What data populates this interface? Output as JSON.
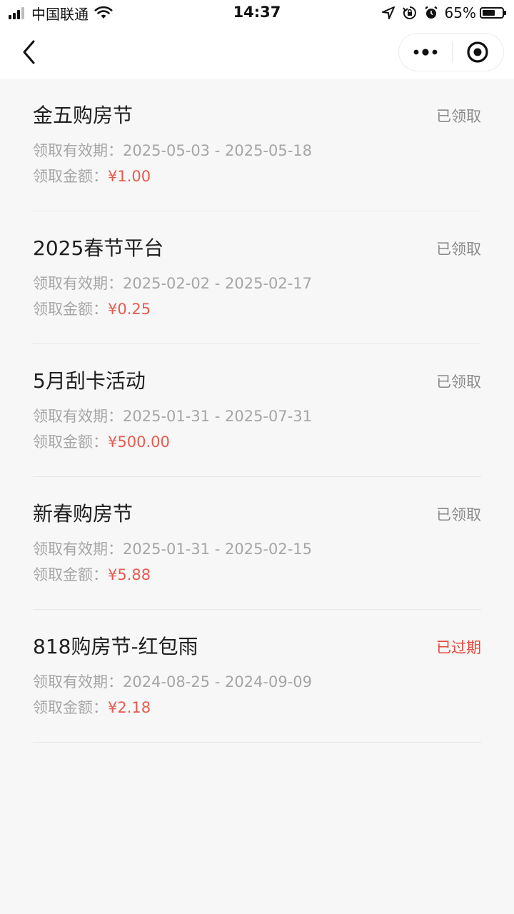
{
  "status_bar": {
    "carrier": "中国联通",
    "time": "14:37",
    "battery": "65%",
    "battery_level": 0.65
  },
  "nav": {
    "back_icon": "chevron-left-icon",
    "more_icon": "more-dots-icon",
    "close_icon": "target-circle-icon"
  },
  "labels": {
    "validity": "领取有效期：",
    "amount": "领取金额："
  },
  "items": [
    {
      "title": "金五购房节",
      "status": "已领取",
      "start": "2025-05-03",
      "end": "2025-05-18",
      "amount": "¥1.00"
    },
    {
      "title": "2025春节平台",
      "status": "已领取",
      "start": "2025-02-02",
      "end": "2025-02-17",
      "amount": "¥0.25"
    },
    {
      "title": "5月刮卡活动",
      "status": "已领取",
      "start": "2025-01-31",
      "end": "2025-07-31",
      "amount": "¥500.00"
    },
    {
      "title": "新春购房节",
      "status": "已领取",
      "start": "2025-01-31",
      "end": "2025-02-15",
      "amount": "¥5.88"
    },
    {
      "title": "818购房节-红包雨",
      "status": "已过期",
      "start": "2024-08-25",
      "end": "2024-09-09",
      "amount": "¥2.18"
    }
  ],
  "colors": {
    "expired": "#e6473a",
    "amount": "#e95a4e",
    "muted": "#a6a6a6"
  }
}
